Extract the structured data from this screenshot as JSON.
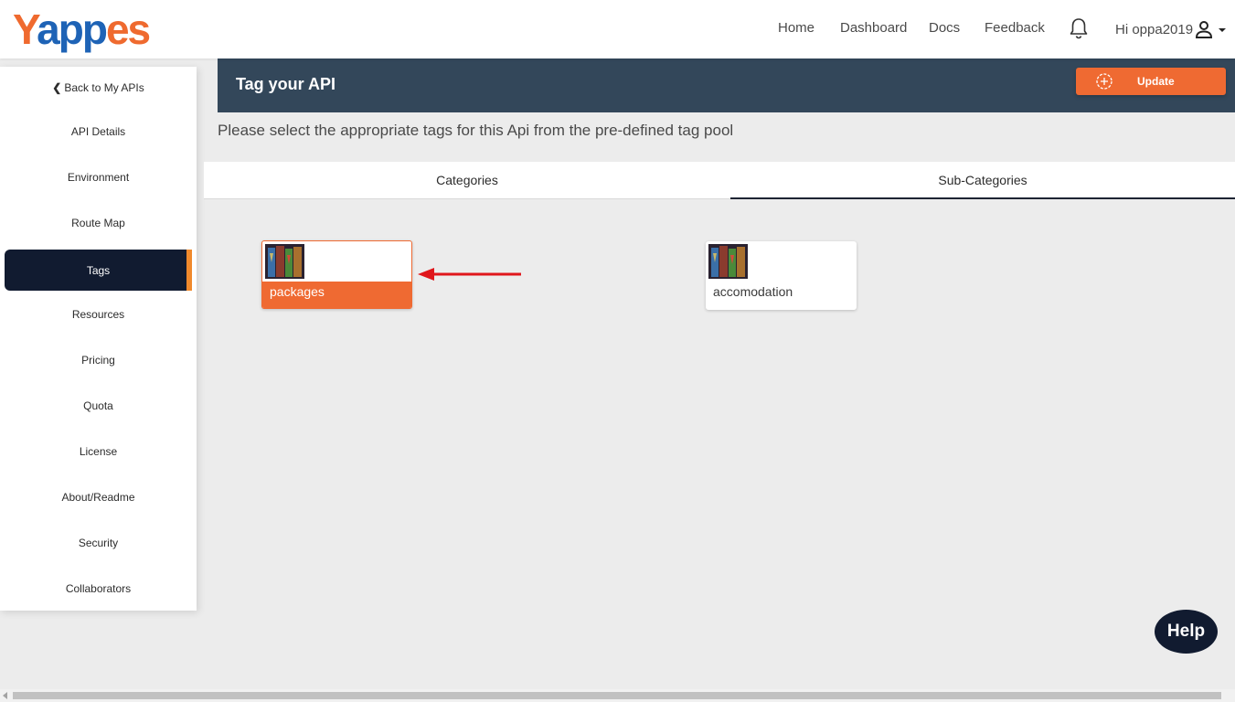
{
  "header": {
    "logo": {
      "part1": "Ya",
      "part2": "ppes",
      "colors": {
        "blue": "#1e63b6",
        "orange": "#ef6a2f"
      }
    },
    "nav": [
      {
        "label": "Home"
      },
      {
        "label": "Dashboard"
      },
      {
        "label": "Docs"
      },
      {
        "label": "Feedback"
      }
    ],
    "notification_icon": "bell-icon",
    "user": {
      "greeting": "Hi oppa2019",
      "icon": "person-icon",
      "menu_icon": "caret-down-icon"
    }
  },
  "sidebar": {
    "back_label": "Back to My APIs",
    "items": [
      {
        "label": "API Details"
      },
      {
        "label": "Environment"
      },
      {
        "label": "Route Map"
      },
      {
        "label": "Tags",
        "active": true
      },
      {
        "label": "Resources"
      },
      {
        "label": "Pricing"
      },
      {
        "label": "Quota"
      },
      {
        "label": "License"
      },
      {
        "label": "About/Readme"
      },
      {
        "label": "Security"
      },
      {
        "label": "Collaborators"
      }
    ],
    "active_color": "#111b30",
    "active_accent": "#f0892c"
  },
  "main": {
    "title": "Tag your API",
    "update_label": "Update",
    "instruction": "Please select the appropriate tags for this Api from the pre-defined tag pool",
    "tabs": [
      {
        "label": "Categories"
      },
      {
        "label": "Sub-Categories",
        "active": true
      }
    ],
    "tags": [
      {
        "label": "packages",
        "selected": true
      },
      {
        "label": "accomodation",
        "selected": false
      }
    ],
    "accent": "#ef6a32",
    "banner_color": "#33475a"
  },
  "help": {
    "label": "Help"
  }
}
